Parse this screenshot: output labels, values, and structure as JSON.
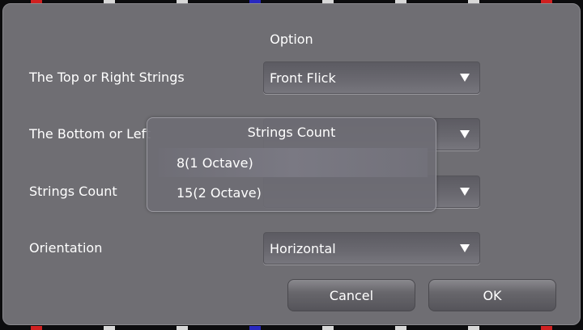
{
  "dialog": {
    "title": "Option",
    "rows": [
      {
        "label": "The Top or Right Strings",
        "value": "Front Flick"
      },
      {
        "label": "The Bottom or Left Strings",
        "value": ""
      },
      {
        "label": "Strings Count",
        "value": ""
      },
      {
        "label": "Orientation",
        "value": "Horizontal"
      }
    ],
    "cancel_label": "Cancel",
    "ok_label": "OK"
  },
  "popup": {
    "title": "Strings Count",
    "options": [
      "8(1 Octave)",
      "15(2 Octave)"
    ],
    "highlighted": "8(1 Octave)"
  },
  "markers": {
    "colors": [
      "#d02020",
      "#d8d8d8",
      "#d8d8d8",
      "#2828c0",
      "#d8d8d8",
      "#d8d8d8",
      "#d8d8d8",
      "#d02020"
    ]
  }
}
